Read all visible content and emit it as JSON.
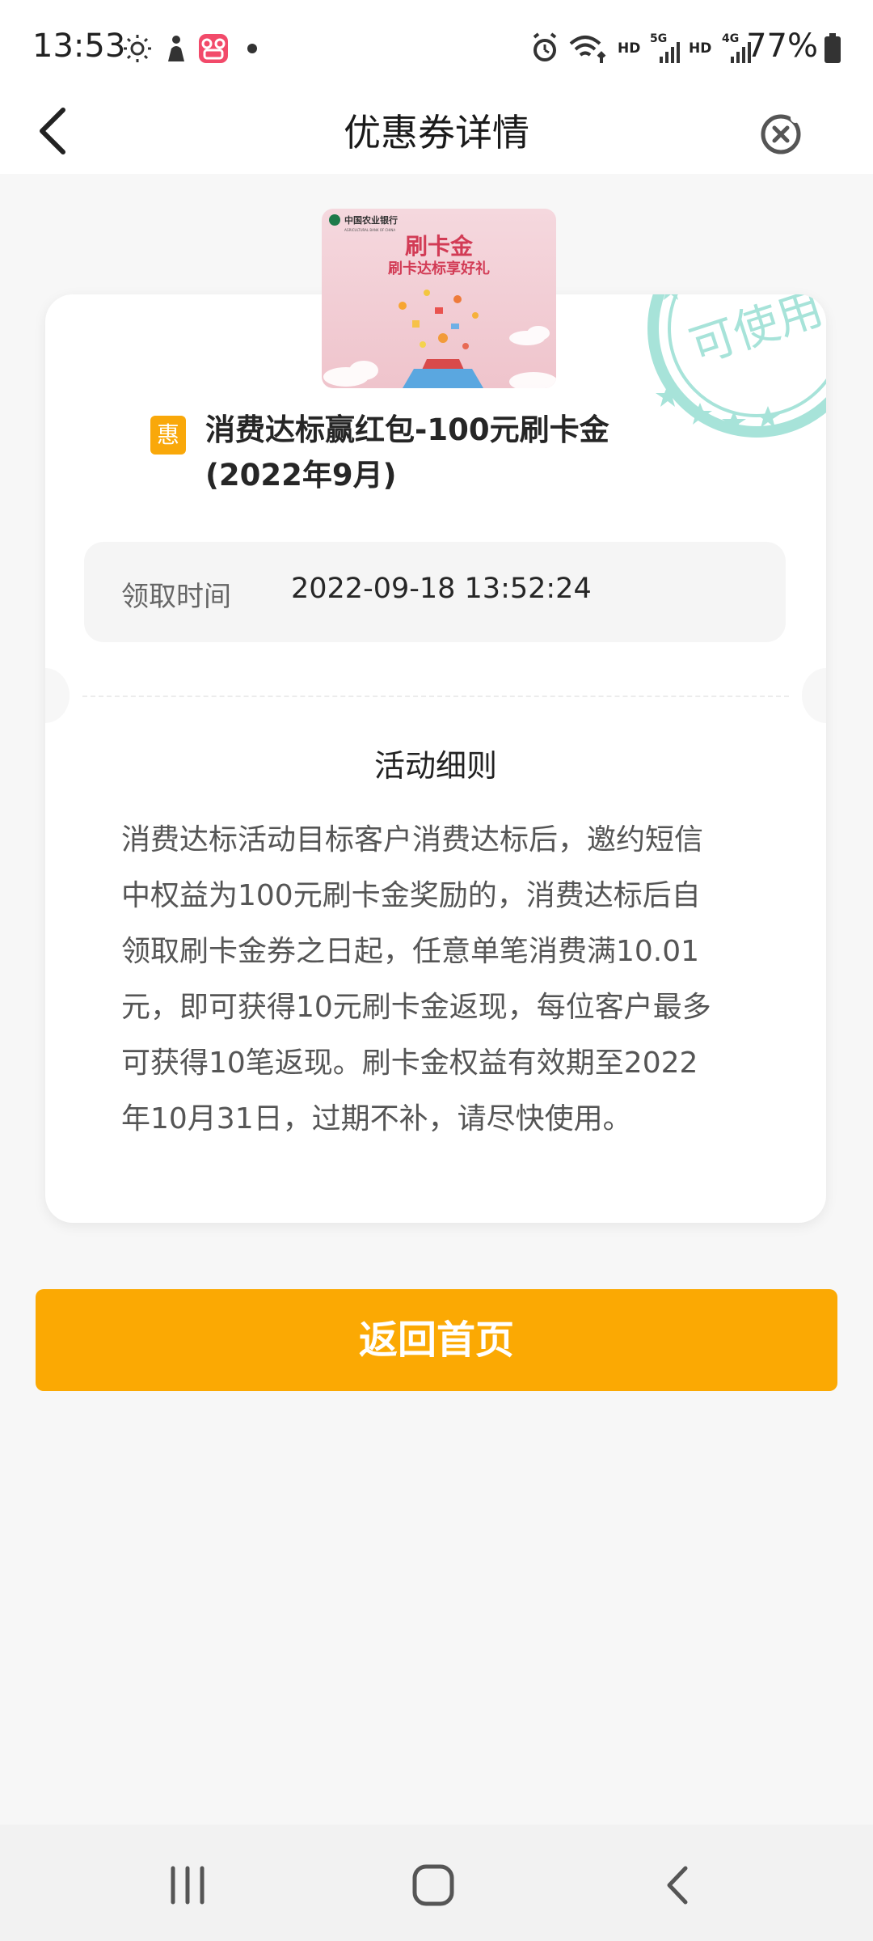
{
  "status_bar": {
    "time": "13:53",
    "battery_percent": "77%",
    "hd_label": "HD",
    "network_5g": "5G",
    "network_4g": "4G",
    "left_icons": [
      "sun-icon",
      "person-icon",
      "app-icon",
      "dot-icon"
    ],
    "right_icons": [
      "alarm-icon",
      "wifi-icon",
      "signal-5g-icon",
      "signal-4g-icon",
      "battery-icon"
    ]
  },
  "nav": {
    "title": "优惠券详情"
  },
  "coupon": {
    "image": {
      "bank_name": "中国农业银行",
      "bank_name_en": "AGRICULTURAL BANK OF CHINA",
      "headline": "刷卡金",
      "subheadline": "刷卡达标享好礼"
    },
    "stamp_text": "可使用",
    "badge_text": "惠",
    "title_line1": "消费达标赢红包-100元刷卡金",
    "title_line2": "(2022年9月)",
    "receive_label": "领取时间",
    "receive_time": "2022-09-18 13:52:24",
    "rules_title": "活动细则",
    "rules_lines": [
      "消费达标活动目标客户消费达标后，邀约短信",
      "中权益为100元刷卡金奖励的，消费达标后自",
      "领取刷卡金券之日起，任意单笔消费满10.01",
      "元，即可获得10元刷卡金返现，每位客户最多",
      "可获得10笔返现。刷卡金权益有效期至2022",
      "年10月31日，过期不补，请尽快使用。"
    ]
  },
  "home_button": {
    "label": "返回首页"
  },
  "colors": {
    "accent": "#fba903",
    "stamp": "#8fdcd0",
    "background": "#f7f7f7"
  }
}
